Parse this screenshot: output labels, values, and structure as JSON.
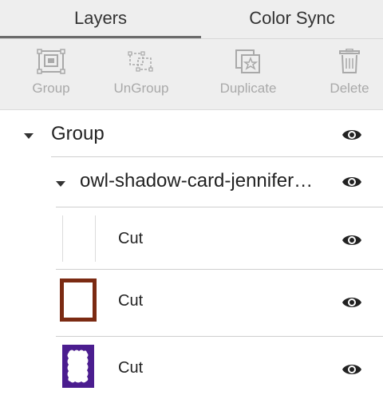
{
  "tabs": [
    {
      "label": "Layers",
      "active": true
    },
    {
      "label": "Color Sync",
      "active": false
    }
  ],
  "toolbar": {
    "group": {
      "label": "Group",
      "icon": "group-icon"
    },
    "ungroup": {
      "label": "UnGroup",
      "icon": "ungroup-icon"
    },
    "duplicate": {
      "label": "Duplicate",
      "icon": "duplicate-icon"
    },
    "delete": {
      "label": "Delete",
      "icon": "trash-icon"
    }
  },
  "layers": {
    "group": {
      "label": "Group",
      "visible": true
    },
    "subgroup": {
      "label": "owl-shadow-card-jennifer…",
      "visible": true
    },
    "items": [
      {
        "label": "Cut",
        "thumb": "blank",
        "color": "#ffffff",
        "visible": true
      },
      {
        "label": "Cut",
        "thumb": "rectangle-frame",
        "color": "#7b2a12",
        "visible": true
      },
      {
        "label": "Cut",
        "thumb": "scalloped-frame",
        "color": "#4b1d8f",
        "visible": true
      }
    ]
  },
  "colors": {
    "panel_bg": "#eeeeee",
    "disabled_text": "#a9a9a9",
    "brown": "#7b2a12",
    "purple": "#4b1d8f"
  }
}
